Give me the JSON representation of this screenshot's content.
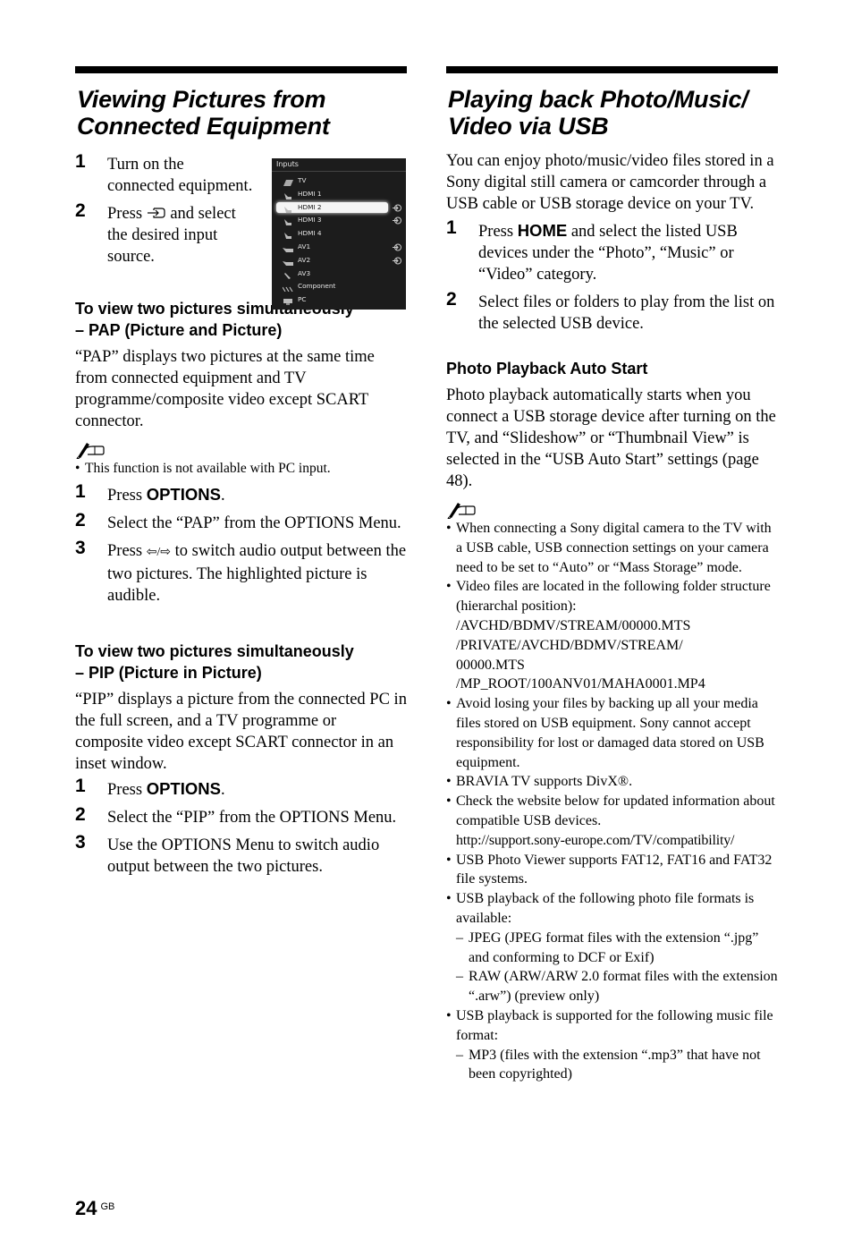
{
  "left": {
    "title_line1": "Viewing Pictures from",
    "title_line2": "Connected Equipment",
    "steps_intro": [
      {
        "num": "1",
        "text": "Turn on the connected equipment."
      },
      {
        "num": "2",
        "pre": "Press",
        "icon": "input-icon",
        "post": "and select the desired input source."
      }
    ],
    "inputs_menu": {
      "title": "Inputs",
      "items": [
        {
          "label": "TV",
          "icon": "tv-icon",
          "has_ext": false,
          "selected": false
        },
        {
          "label": "HDMI 1",
          "icon": "hdmi-icon",
          "has_ext": false,
          "selected": false
        },
        {
          "label": "HDMI 2",
          "icon": "hdmi-icon",
          "has_ext": true,
          "selected": true
        },
        {
          "label": "HDMI 3",
          "icon": "hdmi-icon",
          "has_ext": true,
          "selected": false
        },
        {
          "label": "HDMI 4",
          "icon": "hdmi-icon",
          "has_ext": false,
          "selected": false
        },
        {
          "label": "AV1",
          "icon": "scart-icon",
          "has_ext": true,
          "selected": false
        },
        {
          "label": "AV2",
          "icon": "scart-icon",
          "has_ext": true,
          "selected": false
        },
        {
          "label": "AV3",
          "icon": "composite-icon",
          "has_ext": false,
          "selected": false
        },
        {
          "label": "Component",
          "icon": "component-icon",
          "has_ext": false,
          "selected": false
        },
        {
          "label": "PC",
          "icon": "pc-icon",
          "has_ext": false,
          "selected": false
        }
      ]
    },
    "pap": {
      "heading1": "To view two pictures simultaneously",
      "heading2": "– PAP (Picture and Picture)",
      "body": "“PAP” displays two pictures at the same time from connected equipment and TV programme/composite video except SCART connector.",
      "note": "This function is not available with PC input.",
      "steps": [
        {
          "num": "1",
          "pre": "Press ",
          "bold": "OPTIONS",
          "post": "."
        },
        {
          "num": "2",
          "text": "Select the “PAP” from the OPTIONS Menu."
        },
        {
          "num": "3",
          "pre": "Press ",
          "arrows": "⇦/⇨",
          "post": " to switch audio output between the two pictures. The highlighted picture is audible."
        }
      ]
    },
    "pip": {
      "heading1": "To view two pictures simultaneously",
      "heading2": "– PIP (Picture in Picture)",
      "body": "“PIP” displays a picture from the connected PC in the full screen, and a TV programme or composite video except SCART connector in an inset window.",
      "steps": [
        {
          "num": "1",
          "pre": "Press ",
          "bold": "OPTIONS",
          "post": "."
        },
        {
          "num": "2",
          "text": "Select the “PIP” from the OPTIONS Menu."
        },
        {
          "num": "3",
          "text": "Use the OPTIONS Menu to switch audio output between the two pictures."
        }
      ]
    }
  },
  "right": {
    "title_line1": "Playing back Photo/Music/",
    "title_line2": "Video via USB",
    "intro": "You can enjoy photo/music/video files stored in a Sony digital still camera or camcorder through a USB cable or USB storage device on your TV.",
    "steps": [
      {
        "num": "1",
        "pre": "Press ",
        "bold": "HOME",
        "post": " and select the listed USB devices under the “Photo”, “Music” or “Video” category."
      },
      {
        "num": "2",
        "text": "Select files or folders to play from the list on the selected USB device."
      }
    ],
    "auto_start": {
      "heading": "Photo Playback Auto Start",
      "body": "Photo playback automatically starts when you connect a USB storage device after turning on the TV, and “Slideshow” or “Thumbnail View” is selected in the “USB Auto Start” settings (page 48)."
    },
    "notes": {
      "n1": "When connecting a Sony digital camera to the TV with a USB cable, USB connection settings on your camera need to be set to “Auto” or “Mass Storage” mode.",
      "n2": "Video files are located in the following folder structure (hierarchal position):",
      "paths": [
        "/AVCHD/BDMV/STREAM/00000.MTS",
        "/PRIVATE/AVCHD/BDMV/STREAM/",
        "00000.MTS",
        "/MP_ROOT/100ANV01/MAHA0001.MP4"
      ],
      "n3": "Avoid losing your files by backing up all your media files stored on USB equipment. Sony cannot accept responsibility for lost or damaged data stored on USB equipment.",
      "n4": "BRAVIA TV supports DivX®.",
      "n5": "Check the website below for updated information about compatible USB devices.",
      "n5_url": "http://support.sony-europe.com/TV/compatibility/",
      "n6": "USB Photo Viewer supports FAT12, FAT16 and FAT32 file systems.",
      "n7": "USB playback of the following photo file formats is available:",
      "n7_sub": [
        "JPEG (JPEG format files with the extension “.jpg” and conforming to DCF or Exif)",
        "RAW (ARW/ARW 2.0 format files with the extension “.arw”) (preview only)"
      ],
      "n8": "USB playback is supported for the following music file format:",
      "n8_sub": [
        "MP3 (files with the extension “.mp3” that have not been copyrighted)"
      ]
    }
  },
  "footer": {
    "page_number": "24",
    "page_suffix": "GB"
  }
}
